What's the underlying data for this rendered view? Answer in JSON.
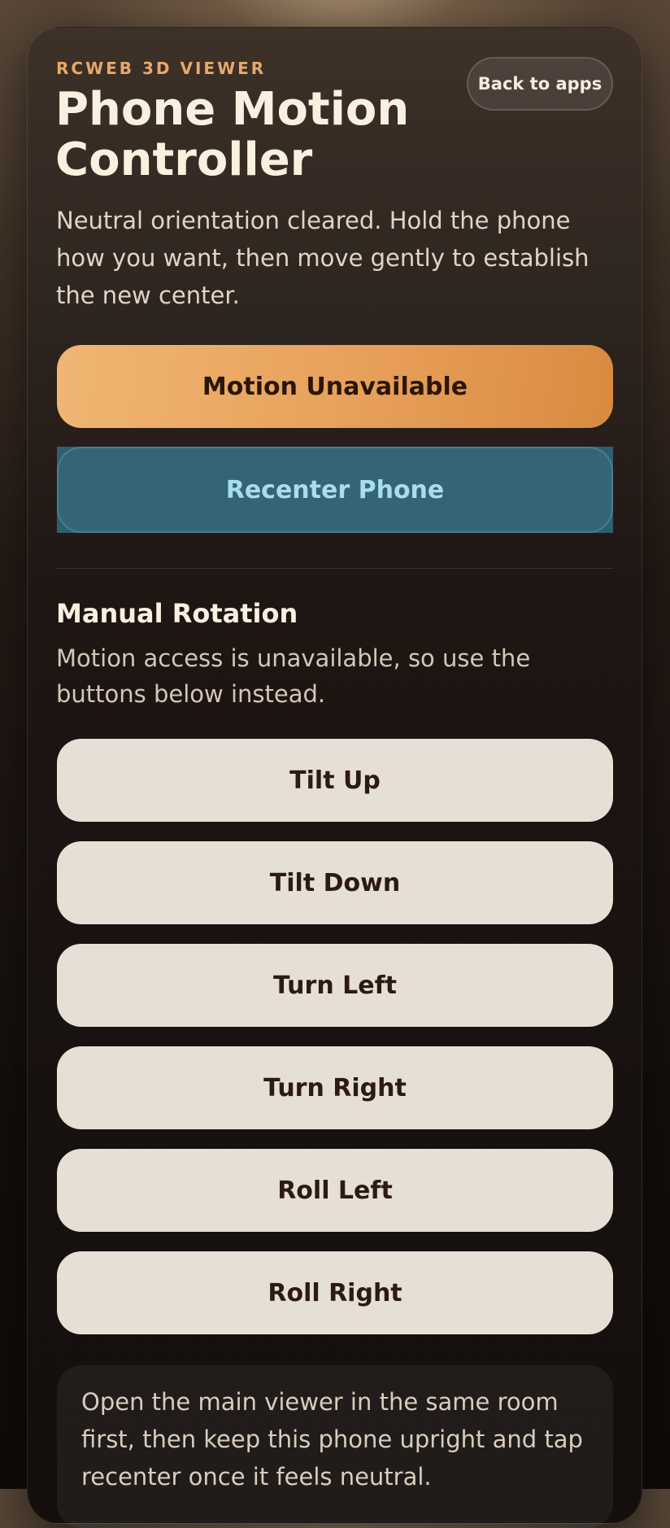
{
  "header": {
    "eyebrow": "RCWEB 3D VIEWER",
    "title": "Phone Motion Controller",
    "back_label": "Back to apps"
  },
  "status_message": "Neutral orientation cleared. Hold the phone how you want, then move gently to establish the new center.",
  "actions": {
    "motion_label": "Motion Unavailable",
    "recenter_label": "Recenter Phone"
  },
  "manual": {
    "title": "Manual Rotation",
    "description": "Motion access is unavailable, so use the buttons below instead.",
    "buttons": [
      {
        "label": "Tilt Up"
      },
      {
        "label": "Tilt Down"
      },
      {
        "label": "Turn Left"
      },
      {
        "label": "Turn Right"
      },
      {
        "label": "Roll Left"
      },
      {
        "label": "Roll Right"
      }
    ]
  },
  "tip": "Open the main viewer in the same room first, then keep this phone upright and tap recenter once it feels neutral.",
  "colors": {
    "accent": "#e7a86a",
    "primary_button": "#e7a05a",
    "secondary_button": "#336576",
    "manual_button": "#e6dfd6"
  }
}
